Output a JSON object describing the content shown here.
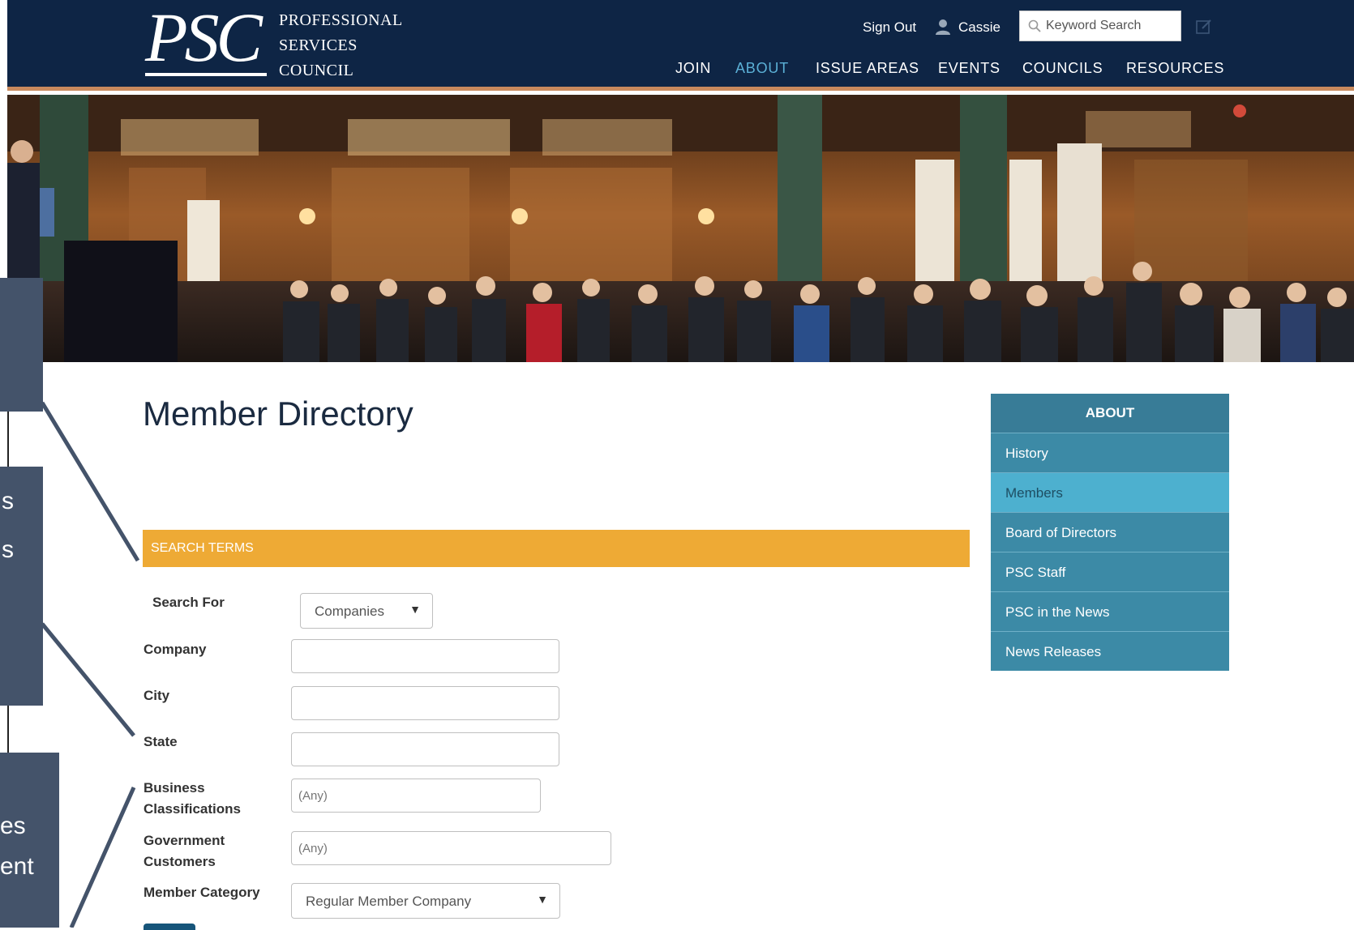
{
  "header": {
    "logo": {
      "mark": "PSC",
      "lines": [
        "PROFESSIONAL",
        "SERVICES",
        "COUNCIL"
      ]
    },
    "sign_out": "Sign Out",
    "username": "Cassie",
    "search_placeholder": "Keyword Search",
    "nav": [
      "JOIN",
      "ABOUT",
      "ISSUE AREAS",
      "EVENTS",
      "COUNCILS",
      "RESOURCES"
    ],
    "active_nav": "ABOUT"
  },
  "hero": {
    "icon": "conference-photo"
  },
  "annotations": [
    {
      "text": "s"
    },
    {
      "text": "s"
    },
    {
      "text": "es"
    },
    {
      "text": "ent"
    }
  ],
  "main": {
    "title": "Member Directory",
    "search_terms_label": "SEARCH TERMS",
    "fields": {
      "search_for": {
        "label": "Search For",
        "value": "Companies"
      },
      "company": {
        "label": "Company",
        "value": ""
      },
      "city": {
        "label": "City",
        "value": ""
      },
      "state": {
        "label": "State",
        "value": ""
      },
      "business": {
        "label_line1": "Business",
        "label_line2": "Classifications",
        "placeholder": "(Any)"
      },
      "government": {
        "label_line1": "Government",
        "label_line2": "Customers",
        "placeholder": "(Any)"
      },
      "member_category": {
        "label": "Member Category",
        "value": "Regular Member Company"
      }
    }
  },
  "sidebar": {
    "heading": "ABOUT",
    "items": [
      {
        "label": "History"
      },
      {
        "label": "Members"
      },
      {
        "label": "Board of Directors"
      },
      {
        "label": "PSC Staff"
      },
      {
        "label": "PSC in the News"
      },
      {
        "label": "News Releases"
      }
    ],
    "active": "Members"
  },
  "colors": {
    "header_bg": "#0e2545",
    "accent_orange": "#eeaa35",
    "sidebar_bg": "#3c8aa6",
    "sidebar_active": "#4db0cf",
    "nav_active": "#5bb0d6",
    "annotation_bg": "#44536a"
  }
}
